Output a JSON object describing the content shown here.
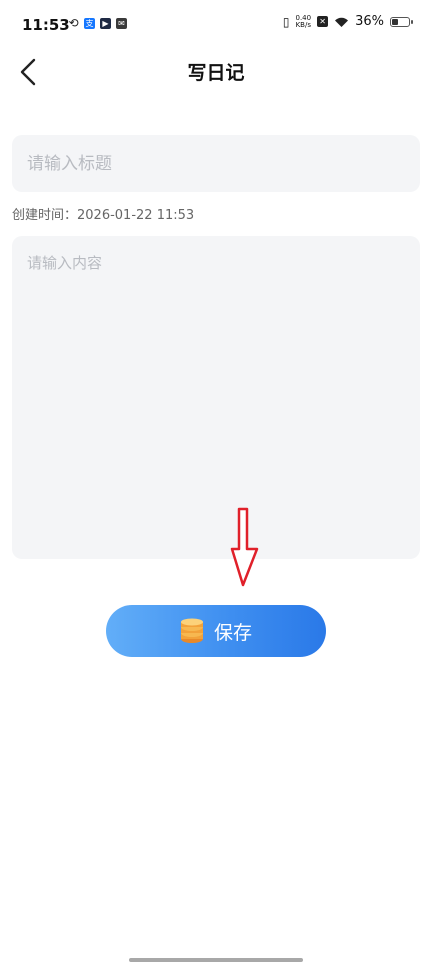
{
  "status_bar": {
    "time": "11:53",
    "net_speed_value": "0.40",
    "net_speed_unit": "KB/s",
    "battery_percent": "36%",
    "battery_level": 0.36,
    "app_icons": [
      "loop-icon",
      "alipay-icon",
      "video-icon",
      "mail-icon"
    ]
  },
  "header": {
    "title": "写日记"
  },
  "form": {
    "title_placeholder": "请输入标题",
    "title_value": "",
    "created_label": "创建时间：",
    "created_time": "2026-01-22 11:53",
    "content_placeholder": "请输入内容",
    "content_value": ""
  },
  "save_button": {
    "label": "保存"
  },
  "colors": {
    "accent_start": "#62aef8",
    "accent_end": "#2a79e8",
    "field_bg": "#f4f5f7",
    "annotation_arrow": "#e0202a"
  }
}
